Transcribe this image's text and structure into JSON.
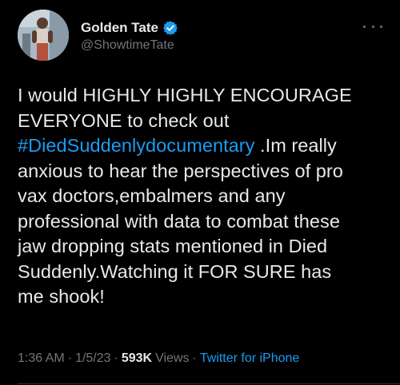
{
  "author": {
    "display_name": "Golden Tate",
    "handle": "@ShowtimeTate",
    "verified": true
  },
  "tweet": {
    "lines": [
      {
        "text": "I would HIGHLY HIGHLY ENCOURAGE"
      },
      {
        "text": "EVERYONE to check out"
      },
      {
        "hashtag": "#DiedSuddenlydocumentary",
        "text": " .Im really"
      },
      {
        "text": "anxious to hear the perspectives of pro"
      },
      {
        "text": "vax doctors,embalmers and any"
      },
      {
        "text": "professional with data to combat these"
      },
      {
        "text": "jaw dropping stats mentioned in Died"
      },
      {
        "text": "Suddenly.Watching it FOR SURE has"
      },
      {
        "text": "me shook!"
      }
    ]
  },
  "meta": {
    "time": "1:36 AM",
    "separator": "·",
    "date": "1/5/23",
    "views_count": "593K",
    "views_label": "Views",
    "source": "Twitter for iPhone"
  },
  "colors": {
    "background": "#000000",
    "text": "#e7e9ea",
    "secondary": "#71767b",
    "accent": "#1d9bf0"
  },
  "icons": {
    "verified": "verified-badge-icon",
    "more": "more-options-icon"
  }
}
